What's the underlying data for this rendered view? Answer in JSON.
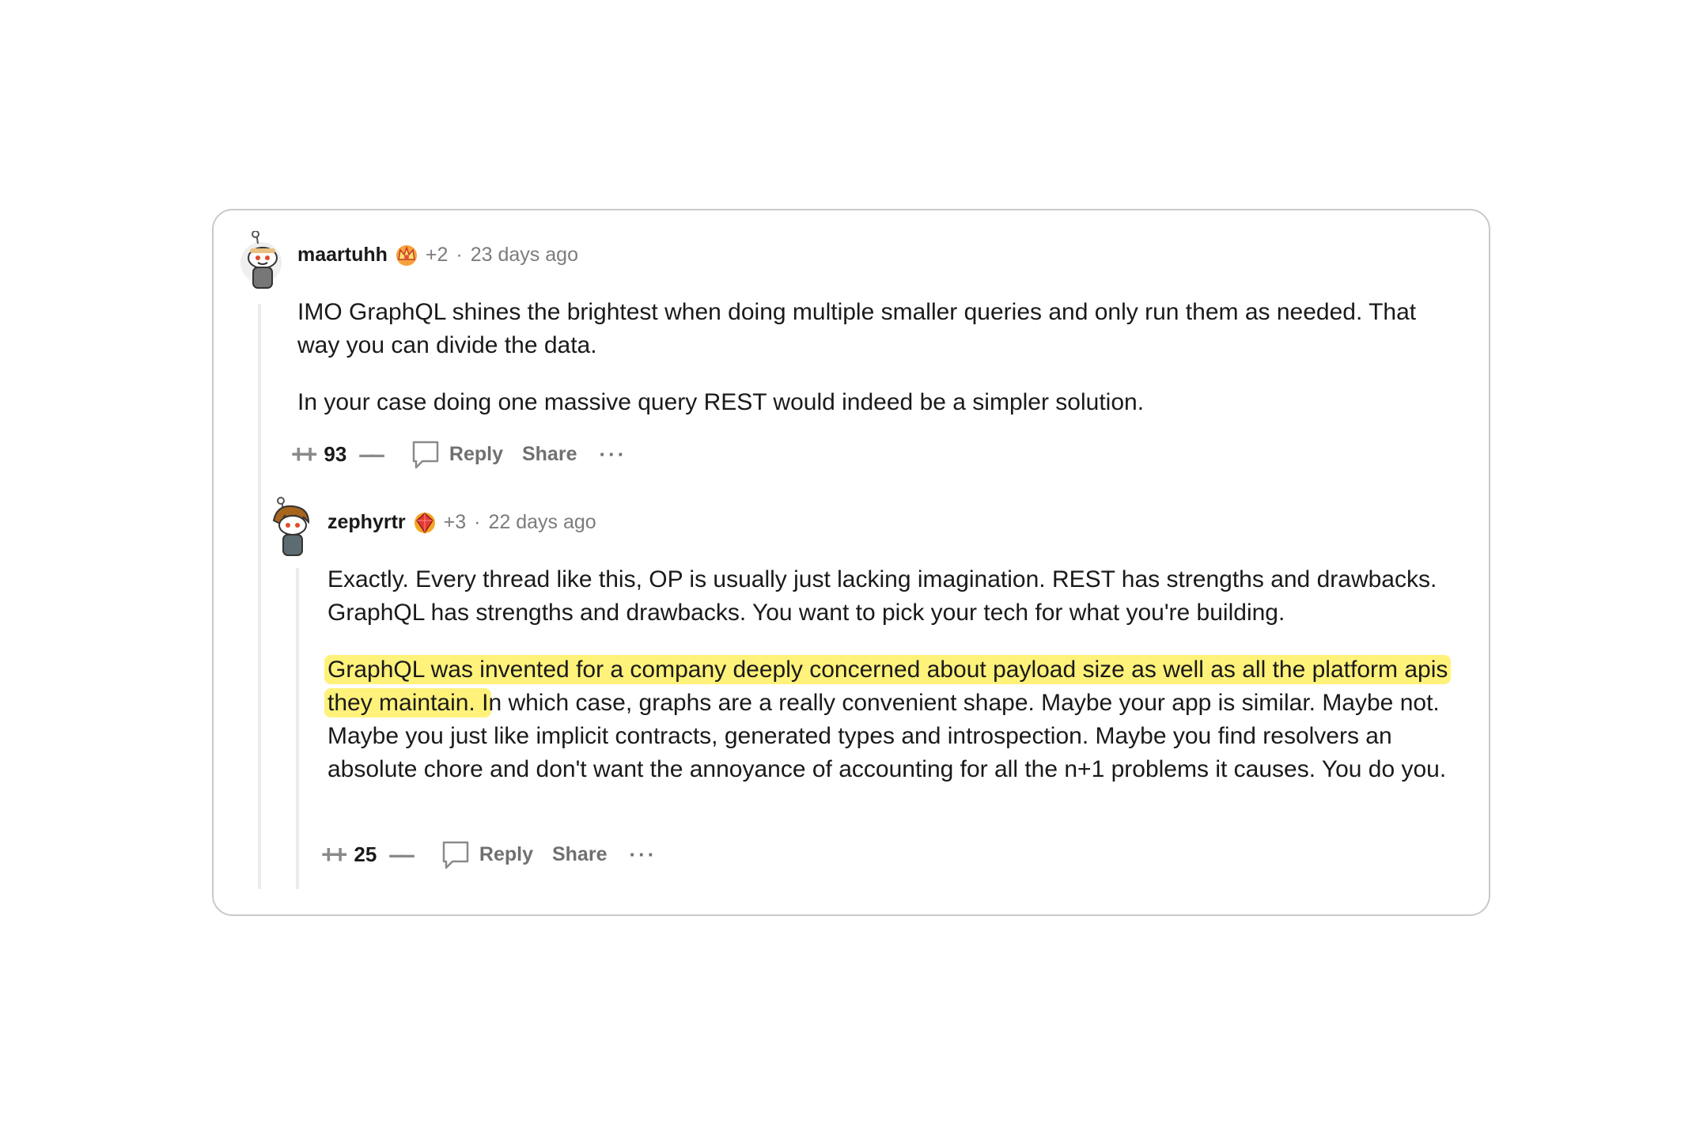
{
  "comments": [
    {
      "username": "maartuhh",
      "score_bonus": "+2",
      "time": "23 days ago",
      "paragraphs": [
        "IMO GraphQL shines the brightest when doing multiple smaller queries and only run them as needed. That way you can divide the data.",
        "In your case doing one massive query REST would indeed be a simpler solution."
      ],
      "votes": "93",
      "reply_label": "Reply",
      "share_label": "Share",
      "more_label": "···",
      "flair_icon": "orange-crown-icon",
      "avatar_icon": "snoo-avatar-icon"
    },
    {
      "username": "zephyrtr",
      "score_bonus": "+3",
      "time": "22 days ago",
      "paragraph1": "Exactly. Every thread like this, OP is usually just lacking imagination. REST has strengths and drawbacks. GraphQL has strengths and drawbacks. You want to pick your tech for what you're building.",
      "highlighted": "GraphQL was invented for a company deeply concerned about payload size as well as all the platform apis they maintain. I",
      "rest": "n which case, graphs are a really convenient shape. Maybe your app is similar. Maybe not. Maybe you just like implicit contracts, generated types and introspection. Maybe you find resolvers an absolute chore and don't want the annoyance of accounting for all the n+1 problems it causes. You do you.",
      "votes": "25",
      "reply_label": "Reply",
      "share_label": "Share",
      "more_label": "···",
      "flair_icon": "red-gem-icon",
      "avatar_icon": "snoo-avatar-icon"
    }
  ],
  "colors": {
    "highlight": "#fff27a",
    "text": "#1a1a1b",
    "muted": "#7c7c7c"
  }
}
